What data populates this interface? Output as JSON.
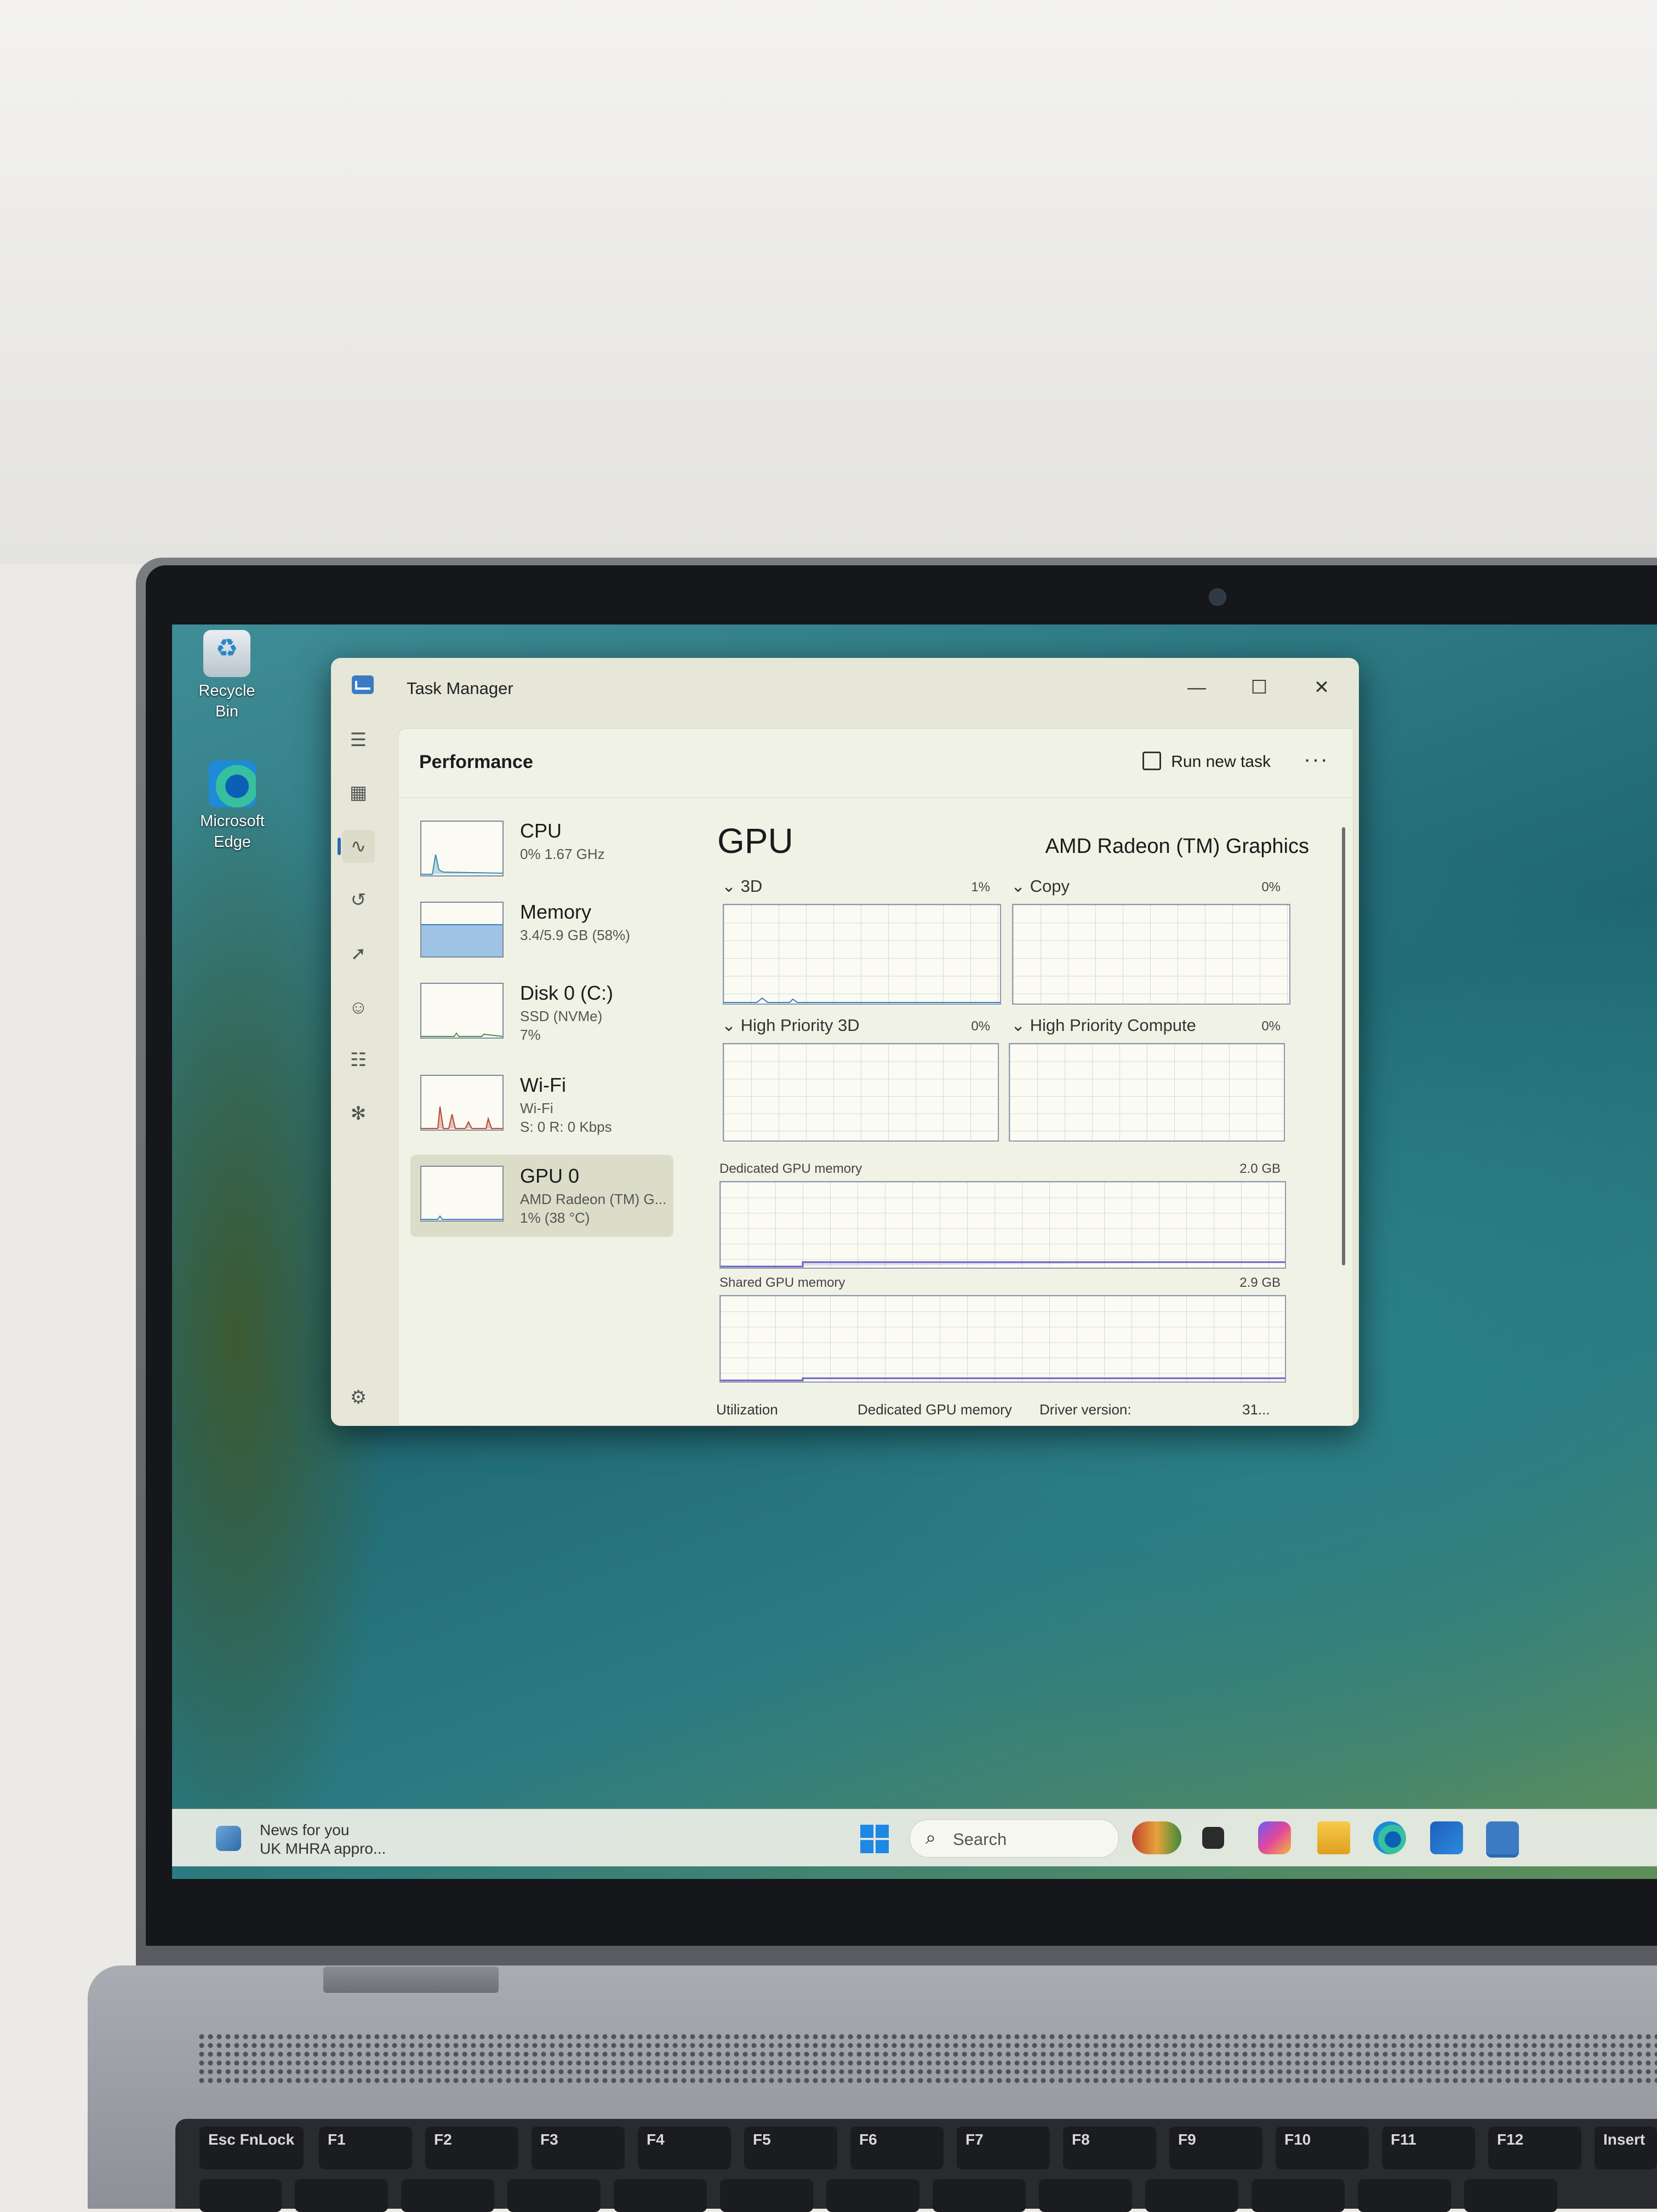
{
  "desktop": {
    "icons": [
      {
        "label": "Recycle Bin"
      },
      {
        "label": "Microsoft Edge"
      }
    ]
  },
  "window": {
    "title": "Task Manager",
    "controls": {
      "minimize": "—",
      "maximize": "☐",
      "close": "✕"
    },
    "page_title": "Performance",
    "run_new_task": "Run new task",
    "more": "···"
  },
  "nav_rail": [
    {
      "icon": "hamburger-menu-icon",
      "glyph": "☰"
    },
    {
      "icon": "processes-icon",
      "glyph": "▦"
    },
    {
      "icon": "performance-icon",
      "glyph": "∿",
      "active": true
    },
    {
      "icon": "app-history-icon",
      "glyph": "↺"
    },
    {
      "icon": "startup-apps-icon",
      "glyph": "➚"
    },
    {
      "icon": "users-icon",
      "glyph": "☺"
    },
    {
      "icon": "details-icon",
      "glyph": "☷"
    },
    {
      "icon": "services-icon",
      "glyph": "✻"
    },
    {
      "icon": "settings-icon",
      "glyph": "⚙"
    }
  ],
  "resources": [
    {
      "name": "CPU",
      "line1": "0% 1.67 GHz",
      "line2": ""
    },
    {
      "name": "Memory",
      "line1": "3.4/5.9 GB (58%)",
      "line2": ""
    },
    {
      "name": "Disk 0 (C:)",
      "line1": "SSD (NVMe)",
      "line2": "7%"
    },
    {
      "name": "Wi-Fi",
      "line1": "Wi-Fi",
      "line2": "S: 0 R: 0 Kbps"
    },
    {
      "name": "GPU 0",
      "line1": "AMD Radeon (TM) G...",
      "line2": "1% (38 °C)",
      "selected": true
    }
  ],
  "gpu": {
    "title": "GPU",
    "model": "AMD Radeon (TM) Graphics",
    "engines": [
      {
        "label": "3D",
        "percent": "1%"
      },
      {
        "label": "Copy",
        "percent": "0%"
      },
      {
        "label": "High Priority 3D",
        "percent": "0%"
      },
      {
        "label": "High Priority Compute",
        "percent": "0%"
      }
    ],
    "dedicated": {
      "label": "Dedicated GPU memory",
      "max": "2.0 GB"
    },
    "shared": {
      "label": "Shared GPU memory",
      "max": "2.9 GB"
    },
    "footer": {
      "utilization": "Utilization",
      "dedicated": "Dedicated GPU memory",
      "driver": "Driver version:",
      "driver_value": "31..."
    }
  },
  "taskbar": {
    "news_title": "News for you",
    "news_sub": "UK MHRA appro...",
    "search_placeholder": "Search",
    "apps": [
      "widgets-icon",
      "task-view-icon",
      "copilot-icon",
      "file-explorer-icon",
      "edge-icon",
      "store-icon",
      "task-manager-icon"
    ]
  },
  "keyboard": {
    "fn_row": [
      "Esc FnLock",
      "F1",
      "F2",
      "F3",
      "F4",
      "F5",
      "F6",
      "F7",
      "F8",
      "F9",
      "F10",
      "F11",
      "F12",
      "Insert"
    ]
  },
  "colors": {
    "accent": "#2b6cb0",
    "graph_border": "#8a9aaa",
    "window_bg": "#e6e7d8"
  }
}
